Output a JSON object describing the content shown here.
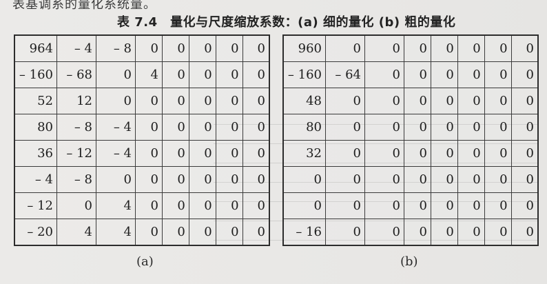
{
  "top_text": "表基调系的量化系统量。",
  "caption": "表 7.4　量化与尺度缩放系数：(a) 细的量化 (b) 粗的量化",
  "table_a": {
    "rows": [
      [
        "964",
        "– 4",
        "– 8",
        "0",
        "0",
        "0",
        "0",
        "0"
      ],
      [
        "– 160",
        "– 68",
        "0",
        "4",
        "0",
        "0",
        "0",
        "0"
      ],
      [
        "52",
        "12",
        "0",
        "0",
        "0",
        "0",
        "0",
        "0"
      ],
      [
        "80",
        "– 8",
        "– 4",
        "0",
        "0",
        "0",
        "0",
        "0"
      ],
      [
        "36",
        "– 12",
        "– 4",
        "0",
        "0",
        "0",
        "0",
        "0"
      ],
      [
        "– 4",
        "– 8",
        "0",
        "0",
        "0",
        "0",
        "0",
        "0"
      ],
      [
        "– 12",
        "0",
        "4",
        "0",
        "0",
        "0",
        "0",
        "0"
      ],
      [
        "– 20",
        "4",
        "4",
        "0",
        "0",
        "0",
        "0",
        "0"
      ]
    ],
    "label": "(a)"
  },
  "table_b": {
    "rows": [
      [
        "960",
        "0",
        "0",
        "0",
        "0",
        "0",
        "0",
        "0"
      ],
      [
        "– 160",
        "– 64",
        "0",
        "0",
        "0",
        "0",
        "0",
        "0"
      ],
      [
        "48",
        "0",
        "0",
        "0",
        "0",
        "0",
        "0",
        "0"
      ],
      [
        "80",
        "0",
        "0",
        "0",
        "0",
        "0",
        "0",
        "0"
      ],
      [
        "32",
        "0",
        "0",
        "0",
        "0",
        "0",
        "0",
        "0"
      ],
      [
        "0",
        "0",
        "0",
        "0",
        "0",
        "0",
        "0",
        "0"
      ],
      [
        "0",
        "0",
        "0",
        "0",
        "0",
        "0",
        "0",
        "0"
      ],
      [
        "– 16",
        "0",
        "0",
        "0",
        "0",
        "0",
        "0",
        "0"
      ]
    ],
    "label": "(b)"
  }
}
